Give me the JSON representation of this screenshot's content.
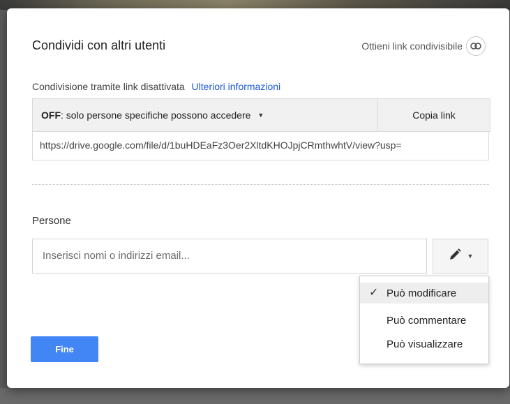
{
  "dialog": {
    "title": "Condividi con altri utenti",
    "get_link_label": "Ottieni link condivisibile",
    "get_link_icon": "link-icon"
  },
  "link_sharing": {
    "status_text": "Condivisione tramite link disattivata",
    "more_info_link": "Ulteriori informazioni",
    "access_state": "OFF",
    "access_description": ": solo persone specifiche possono accedere",
    "copy_link_label": "Copia link",
    "url": "https://drive.google.com/file/d/1buHDEaFz3Oer2XltdKHOJpjCRmthwhtV/view?usp="
  },
  "people": {
    "label": "Persone",
    "input_placeholder": "Inserisci nomi o indirizzi email...",
    "permission_icon": "pencil-icon"
  },
  "permission_menu": {
    "items": [
      {
        "label": "Può modificare",
        "selected": true
      },
      {
        "label": "Può commentare",
        "selected": false
      },
      {
        "label": "Può visualizzare",
        "selected": false
      }
    ]
  },
  "footer": {
    "done_label": "Fine"
  },
  "colors": {
    "primary_button": "#4285f4",
    "link": "#1a58d6"
  }
}
